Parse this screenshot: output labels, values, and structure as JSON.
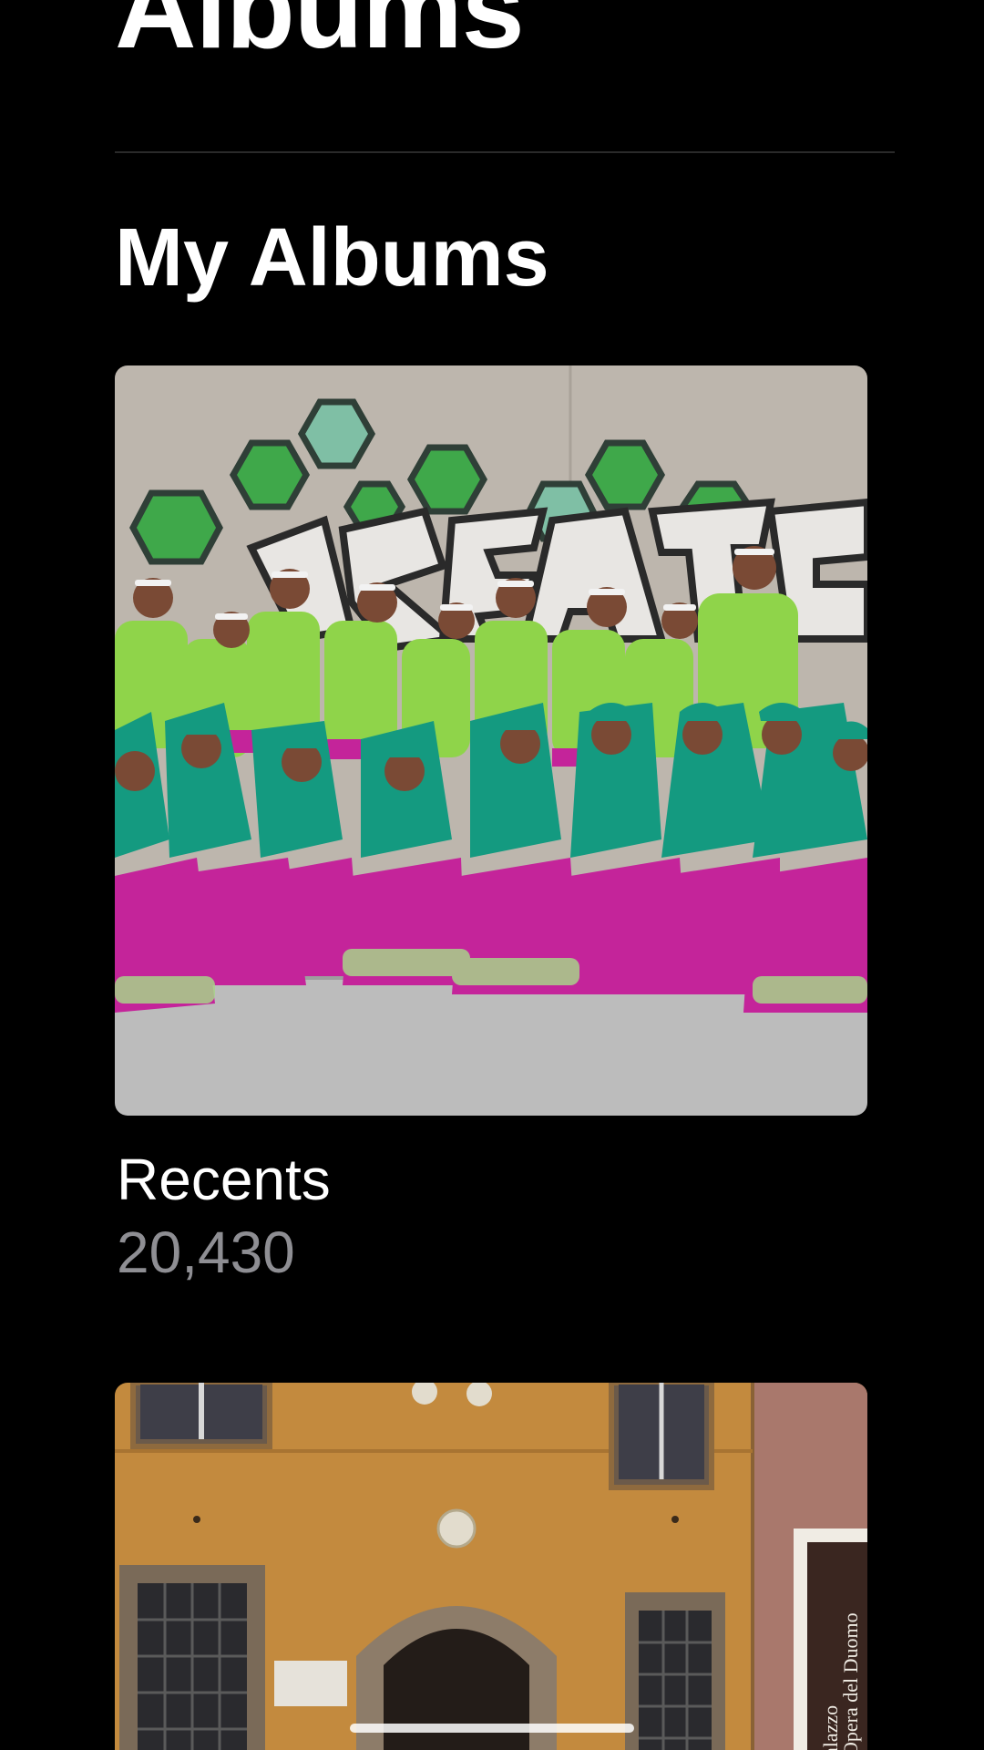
{
  "header": {
    "title": "Albums"
  },
  "sections": {
    "my_albums": {
      "title": "My Albums",
      "albums": [
        {
          "name": "Recents",
          "count": "20,430"
        }
      ]
    }
  },
  "second_album_sign": {
    "line1": "alazzo",
    "line2": "Opera del Duomo"
  },
  "colors": {
    "background": "#000000",
    "primary_text": "#ffffff",
    "secondary_text": "#8e8e93",
    "divider": "#2a2a2a"
  }
}
